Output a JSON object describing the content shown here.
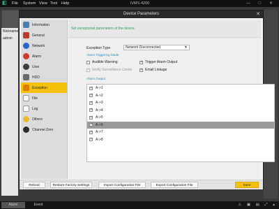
{
  "app": {
    "title": "iVMS-4200",
    "menu": [
      "File",
      "System",
      "View",
      "Tool",
      "Help"
    ],
    "window_controls": "— □ ✕"
  },
  "background": {
    "left_panel_header": "Nickname",
    "left_panel_row": "admin"
  },
  "dialog": {
    "title": "Device Parameters",
    "close": "✕",
    "nav": [
      {
        "label": "Information",
        "icon": "information-icon",
        "color": "#4a7fb5"
      },
      {
        "label": "General",
        "icon": "general-icon",
        "color": "#c0392b"
      },
      {
        "label": "Network",
        "icon": "network-icon",
        "color": "#2a64c8"
      },
      {
        "label": "Alarm",
        "icon": "alarm-icon",
        "color": "#d0392b"
      },
      {
        "label": "User",
        "icon": "user-icon",
        "color": "#3d3d3d"
      },
      {
        "label": "HDD",
        "icon": "hdd-icon",
        "color": "#6a6a6a"
      },
      {
        "label": "Exception",
        "icon": "exception-icon",
        "color": "#e07b00"
      },
      {
        "label": "File",
        "icon": "file-icon",
        "color": "#e8e8e8"
      },
      {
        "label": "Log",
        "icon": "log-icon",
        "color": "#f2f2f2"
      },
      {
        "label": "Others",
        "icon": "others-icon",
        "color": "#e8b83a"
      },
      {
        "label": "Channel Zero",
        "icon": "channel-zero-icon",
        "color": "#2b2b2b"
      }
    ],
    "active_nav": "Exception",
    "description": "Set exceptional parameters of the device.",
    "exception_type_label": "Exception Type",
    "exception_type_value": "Network Disconnected",
    "alarm_triggering_mode": "Alarm Triggering Mode",
    "checkboxes": {
      "audible_warning": {
        "label": "Audible Warning",
        "checked": false
      },
      "notify_surveillance_center": {
        "label": "Notify Surveillance Center",
        "checked": true
      },
      "trigger_alarm_output": {
        "label": "Trigger Alarm Output",
        "checked": true
      },
      "email_linkage": {
        "label": "Email Linkage",
        "checked": true
      }
    },
    "alarm_output_label": "Alarm Output",
    "alarm_outputs": [
      {
        "label": "A->1",
        "checked": true
      },
      {
        "label": "A->2",
        "checked": true
      },
      {
        "label": "A->3",
        "checked": true
      },
      {
        "label": "A->4",
        "checked": true
      },
      {
        "label": "A->5",
        "checked": true
      },
      {
        "label": "A->6",
        "checked": true
      },
      {
        "label": "A->7",
        "checked": true
      },
      {
        "label": "A->8",
        "checked": true
      }
    ],
    "selected_output": "A->6",
    "buttons": {
      "reboot": "Reboot",
      "restore": "Restore Factory Settings",
      "import": "Import Configuration File",
      "export": "Export Configuration File",
      "save": "Save"
    }
  },
  "statusbar": {
    "tabs": [
      "Alarm",
      "Event"
    ],
    "tray": "⚠ ▣ ▤ ⤢ ▴"
  }
}
